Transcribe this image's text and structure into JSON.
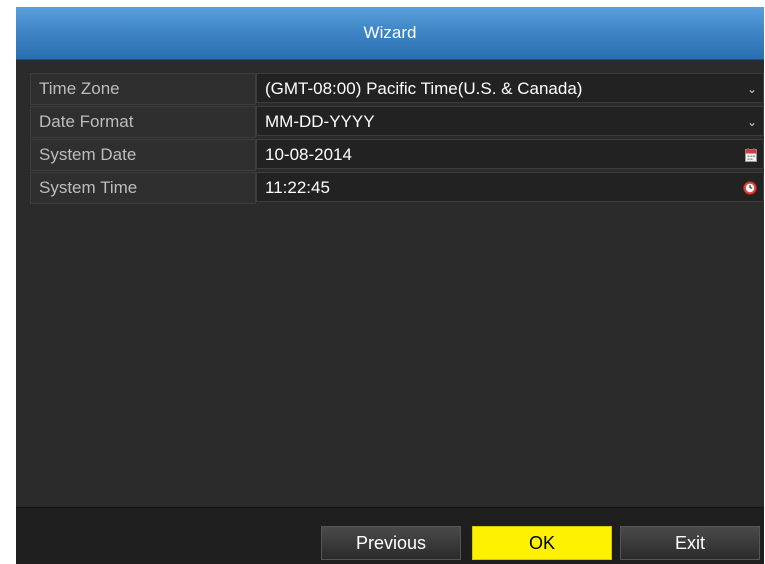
{
  "window": {
    "title": "Wizard"
  },
  "form": {
    "rows": [
      {
        "label": "Time Zone",
        "value": "(GMT-08:00) Pacific Time(U.S. & Canada)",
        "icon": "chevron-down-icon"
      },
      {
        "label": "Date Format",
        "value": "MM-DD-YYYY",
        "icon": "chevron-down-icon"
      },
      {
        "label": "System Date",
        "value": "10-08-2014",
        "icon": "calendar-icon"
      },
      {
        "label": "System Time",
        "value": "11:22:45",
        "icon": "clock-icon"
      }
    ]
  },
  "footer": {
    "previous_label": "Previous",
    "ok_label": "OK",
    "exit_label": "Exit"
  },
  "colors": {
    "title_bar": "#3f86c7",
    "ok_button": "#fff200",
    "background": "#2b2b2b"
  }
}
